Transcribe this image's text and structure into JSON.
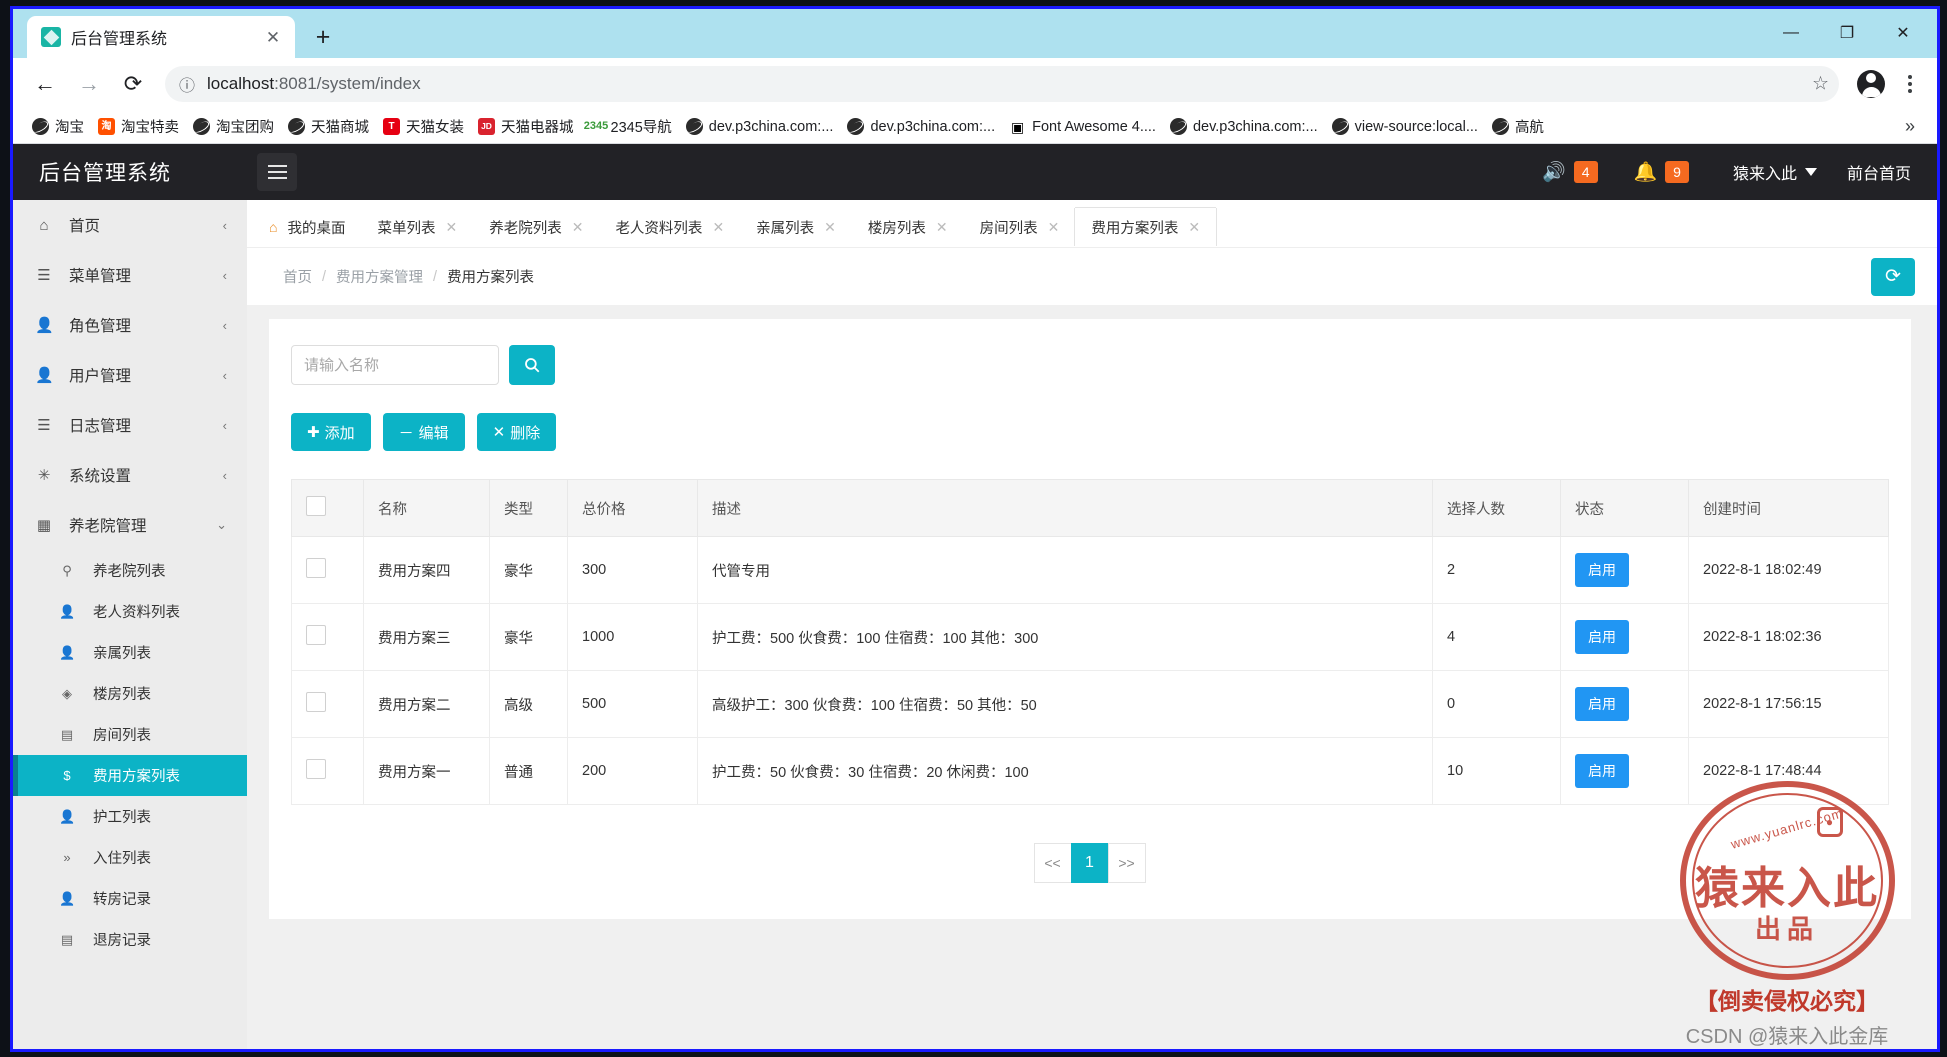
{
  "browser": {
    "tab_title": "后台管理系统",
    "tab_close": "✕",
    "new_tab": "+",
    "minimize": "—",
    "maximize": "❐",
    "close": "✕",
    "back": "←",
    "forward": "→",
    "reload": "⟳",
    "info_icon": "ⓘ",
    "url_host": "localhost",
    "url_rest": ":8081/system/index",
    "star": "☆",
    "bookmarks_overflow": "»",
    "bookmarks": [
      {
        "label": "淘宝",
        "icon": "globe-icon",
        "style": "ic-globe",
        "glyph": ""
      },
      {
        "label": "淘宝特卖",
        "icon": "taobao-icon",
        "style": "ic-tb",
        "glyph": "淘"
      },
      {
        "label": "淘宝团购",
        "icon": "globe-icon",
        "style": "ic-globe",
        "glyph": ""
      },
      {
        "label": "天猫商城",
        "icon": "globe-icon",
        "style": "ic-globe",
        "glyph": ""
      },
      {
        "label": "天猫女装",
        "icon": "tmall-icon",
        "style": "ic-red",
        "glyph": "T"
      },
      {
        "label": "天猫电器城",
        "icon": "jd-icon",
        "style": "ic-jd",
        "glyph": "JD"
      },
      {
        "label": "2345导航",
        "icon": "2345-icon",
        "style": "ic-2345",
        "glyph": "2345"
      },
      {
        "label": "dev.p3china.com:...",
        "icon": "globe-icon",
        "style": "ic-globe",
        "glyph": ""
      },
      {
        "label": "dev.p3china.com:...",
        "icon": "globe-icon",
        "style": "ic-globe",
        "glyph": ""
      },
      {
        "label": "Font Awesome 4....",
        "icon": "image-icon",
        "style": "ic-fa",
        "glyph": "▣"
      },
      {
        "label": "dev.p3china.com:...",
        "icon": "globe-icon",
        "style": "ic-globe",
        "glyph": ""
      },
      {
        "label": "view-source:local...",
        "icon": "globe-icon",
        "style": "ic-globe",
        "glyph": ""
      },
      {
        "label": "高航",
        "icon": "globe-icon",
        "style": "ic-globe",
        "glyph": ""
      }
    ]
  },
  "app": {
    "brand": "后台管理系统",
    "menu_toggle": "menu",
    "sound_count": "4",
    "bell_count": "9",
    "user_name": "猿来入此",
    "front_page_link": "前台首页"
  },
  "sidebar": {
    "items": [
      {
        "label": "首页",
        "icon": "home-icon",
        "glyph": "⌂",
        "chevron": "‹"
      },
      {
        "label": "菜单管理",
        "icon": "list-icon",
        "glyph": "☰",
        "chevron": "‹"
      },
      {
        "label": "角色管理",
        "icon": "user-icon",
        "glyph": "👤",
        "chevron": "‹"
      },
      {
        "label": "用户管理",
        "icon": "user-icon",
        "glyph": "👤",
        "chevron": "‹"
      },
      {
        "label": "日志管理",
        "icon": "list-icon",
        "glyph": "☰",
        "chevron": "‹"
      },
      {
        "label": "系统设置",
        "icon": "gear-icon",
        "glyph": "✳",
        "chevron": "‹"
      },
      {
        "label": "养老院管理",
        "icon": "grid-icon",
        "glyph": "▦",
        "chevron": "⌄"
      }
    ],
    "sub_items": [
      {
        "label": "养老院列表",
        "icon": "pin-icon",
        "glyph": "⚲",
        "active": false
      },
      {
        "label": "老人资料列表",
        "icon": "user-icon",
        "glyph": "👤",
        "active": false
      },
      {
        "label": "亲属列表",
        "icon": "user-icon",
        "glyph": "👤",
        "active": false
      },
      {
        "label": "楼房列表",
        "icon": "layers-icon",
        "glyph": "◈",
        "active": false
      },
      {
        "label": "房间列表",
        "icon": "door-icon",
        "glyph": "▤",
        "active": false
      },
      {
        "label": "费用方案列表",
        "icon": "dollar-icon",
        "glyph": "$",
        "active": true
      },
      {
        "label": "护工列表",
        "icon": "user-icon",
        "glyph": "👤",
        "active": false
      },
      {
        "label": "入住列表",
        "icon": "chevrons-icon",
        "glyph": "»",
        "active": false
      },
      {
        "label": "转房记录",
        "icon": "user-icon",
        "glyph": "👤",
        "active": false
      },
      {
        "label": "退房记录",
        "icon": "door-icon",
        "glyph": "▤",
        "active": false
      }
    ]
  },
  "content_tabs": [
    {
      "label": "我的桌面",
      "closable": false,
      "active": false,
      "home": true
    },
    {
      "label": "菜单列表",
      "closable": true,
      "active": false
    },
    {
      "label": "养老院列表",
      "closable": true,
      "active": false
    },
    {
      "label": "老人资料列表",
      "closable": true,
      "active": false
    },
    {
      "label": "亲属列表",
      "closable": true,
      "active": false
    },
    {
      "label": "楼房列表",
      "closable": true,
      "active": false
    },
    {
      "label": "房间列表",
      "closable": true,
      "active": false
    },
    {
      "label": "费用方案列表",
      "closable": true,
      "active": true
    }
  ],
  "breadcrumb": {
    "items": [
      "首页",
      "费用方案管理",
      "费用方案列表"
    ],
    "separator": "/",
    "refresh_icon": "⟳"
  },
  "toolbar": {
    "search_placeholder": "请输入名称",
    "search_value": "",
    "search_icon": "🔍",
    "add_label": "添加",
    "add_icon": "✚",
    "edit_label": "编辑",
    "edit_icon": "－",
    "delete_label": "删除",
    "delete_icon": "✕"
  },
  "table": {
    "columns": [
      "",
      "名称",
      "类型",
      "总价格",
      "描述",
      "选择人数",
      "状态",
      "创建时间"
    ],
    "rows": [
      {
        "name": "费用方案四",
        "type": "豪华",
        "price": "300",
        "desc": "代管专用",
        "count": "2",
        "status": "启用",
        "created": "2022-8-1 18:02:49"
      },
      {
        "name": "费用方案三",
        "type": "豪华",
        "price": "1000",
        "desc": "护工费：500 伙食费：100 住宿费：100 其他：300",
        "count": "4",
        "status": "启用",
        "created": "2022-8-1 18:02:36"
      },
      {
        "name": "费用方案二",
        "type": "高级",
        "price": "500",
        "desc": "高级护工：300 伙食费：100 住宿费：50 其他：50",
        "count": "0",
        "status": "启用",
        "created": "2022-8-1 17:56:15"
      },
      {
        "name": "费用方案一",
        "type": "普通",
        "price": "200",
        "desc": "护工费：50 伙食费：30 住宿费：20 休闲费：100",
        "count": "10",
        "status": "启用",
        "created": "2022-8-1 17:48:44"
      }
    ]
  },
  "pagination": {
    "prev": "<<",
    "current": "1",
    "next": ">>"
  },
  "watermark": {
    "url": "www.yuanlrc.com",
    "main": "猿来入此",
    "sub": "出品",
    "warning": "【倒卖侵权必究】",
    "csdn": "CSDN @猿来入此金库"
  },
  "colors": {
    "accent": "#0cb3c6",
    "status_blue": "#2196f3",
    "badge_orange": "#f56a20",
    "header_dark": "#222226",
    "stamp_red": "#c0392b"
  }
}
